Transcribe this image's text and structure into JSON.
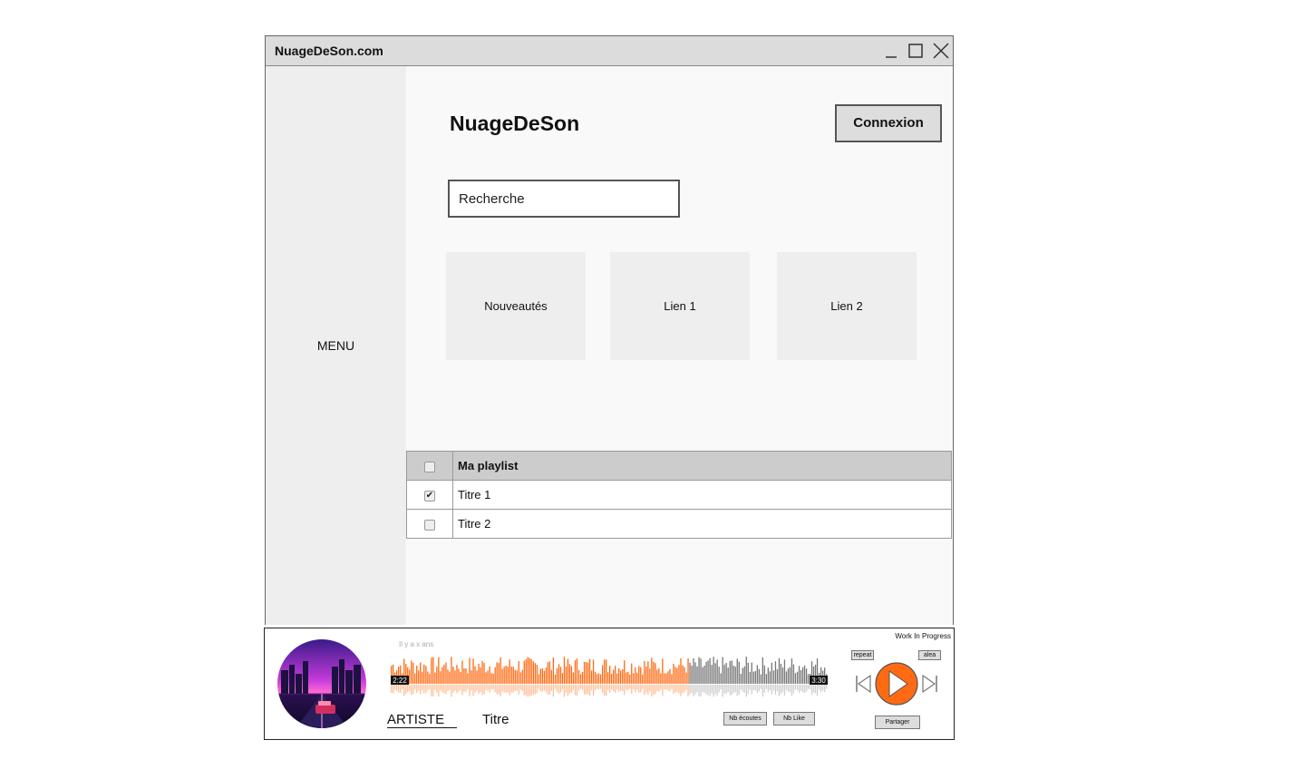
{
  "window": {
    "title": "NuageDeSon.com"
  },
  "sidebar": {
    "menu_label": "MENU"
  },
  "header": {
    "app_title": "NuageDeSon",
    "login_label": "Connexion"
  },
  "search": {
    "placeholder": "Recherche"
  },
  "tiles": [
    {
      "label": "Nouveautés"
    },
    {
      "label": "Lien 1"
    },
    {
      "label": "Lien 2"
    }
  ],
  "playlist": {
    "header": "Ma playlist",
    "rows": [
      {
        "title": "Titre 1",
        "checked": true
      },
      {
        "title": "Titre 2",
        "checked": false
      }
    ]
  },
  "player": {
    "status_tag": "Work In Progress",
    "posted_ago": "Il y a x ans",
    "current_time": "2:22",
    "duration": "3:30",
    "progress": 0.68,
    "artist": "ARTISTE",
    "title": "Titre",
    "listens_label": "Nb écoutes",
    "likes_label": "Nb Like",
    "share_label": "Partager",
    "repeat_label": "repeat",
    "shuffle_label": "alea",
    "accent_color": "#ff6a13"
  }
}
